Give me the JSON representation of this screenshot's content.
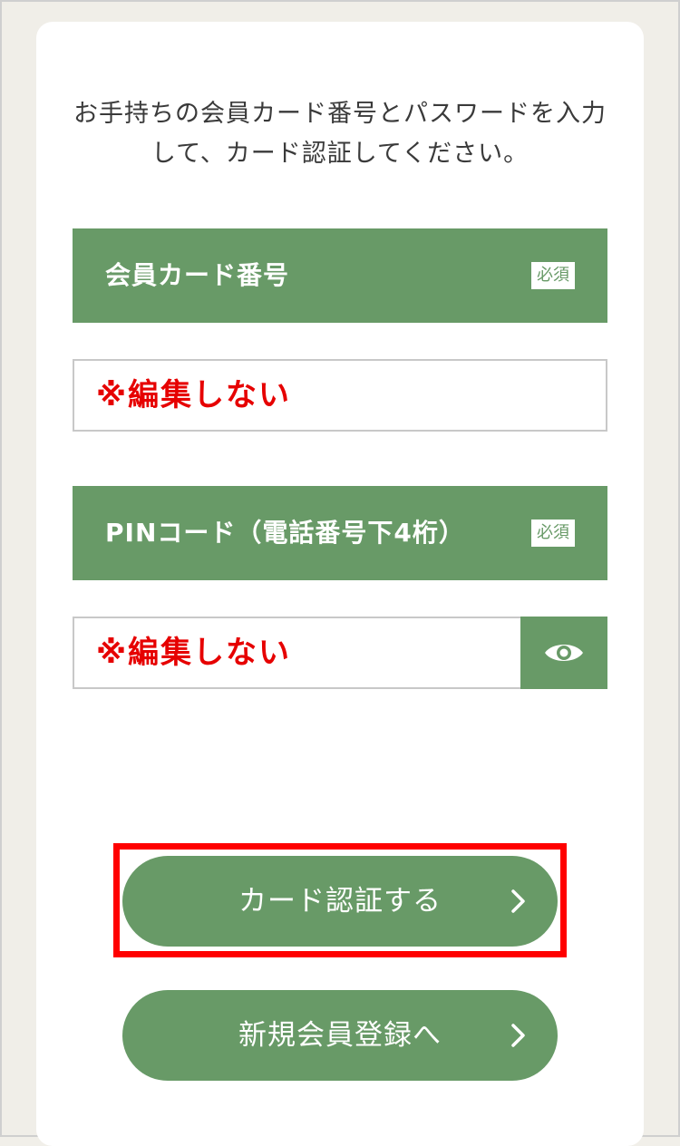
{
  "intro": {
    "line1": "お手持ちの会員カード番号とパスワードを入力",
    "line2": "して、カード認証してください。"
  },
  "card_number": {
    "label": "会員カード番号",
    "required_badge": "必須",
    "value": "※編集しない"
  },
  "pin": {
    "label": "PINコード（電話番号下4桁）",
    "required_badge": "必須",
    "value": "※編集しない",
    "toggle_icon": "eye-icon"
  },
  "buttons": {
    "authenticate_label": "カード認証する",
    "register_label": "新規会員登録へ"
  },
  "colors": {
    "accent": "#689a67",
    "warning_text": "#e60000",
    "highlight_border": "#ff0000"
  }
}
